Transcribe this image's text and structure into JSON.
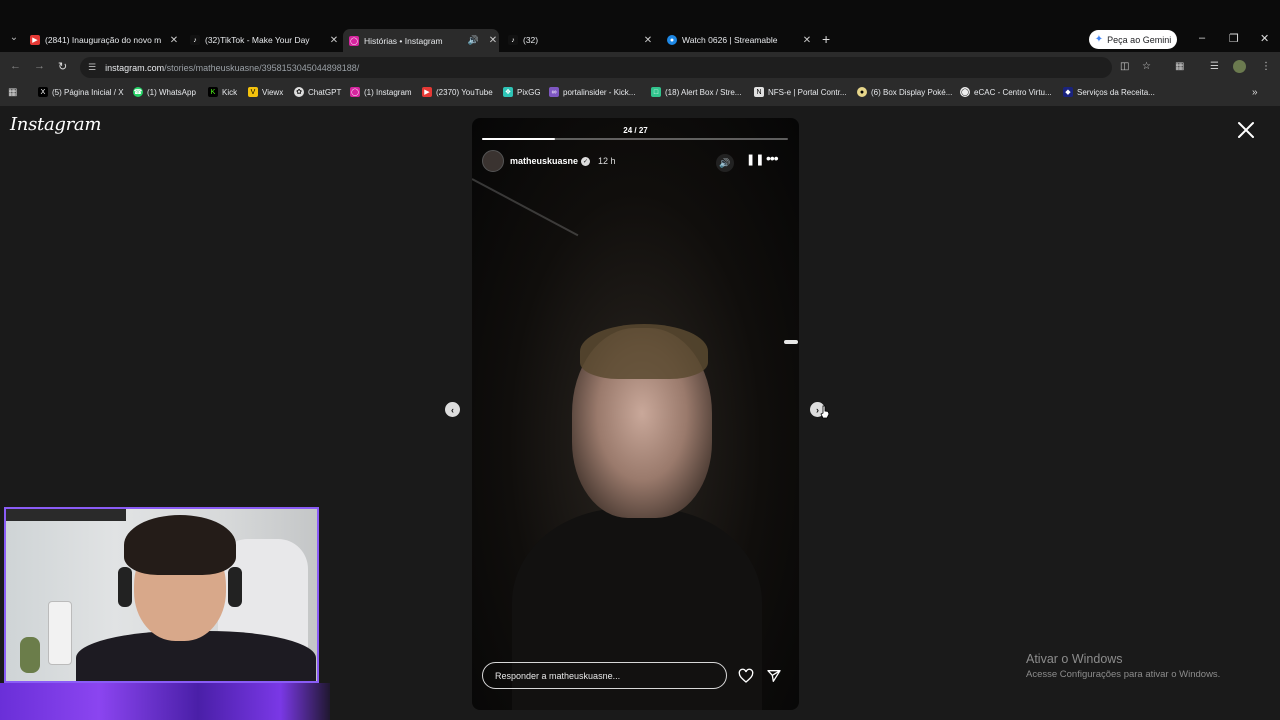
{
  "browser": {
    "tabs": [
      {
        "title": "(2841) Inauguração do novo m",
        "favicon": "youtube-icon",
        "color": "#e53935"
      },
      {
        "title": "(32)TikTok - Make Your Day",
        "favicon": "tiktok-icon",
        "color": "#111111"
      },
      {
        "title": "Histórias • Instagram",
        "favicon": "instagram-icon",
        "color": "#d6249f",
        "active": true
      },
      {
        "title": "(32)",
        "favicon": "tiktok-icon",
        "color": "#111111"
      },
      {
        "title": "Watch 0626 | Streamable",
        "favicon": "streamable-icon",
        "color": "#1e88e5"
      }
    ],
    "gemini_label": "Peça ao Gemini",
    "url_host": "instagram.com",
    "url_path": "/stories/matheuskuasne/3958153045044898188/",
    "bookmarks": [
      {
        "label": "(5) Página Inicial / X",
        "icon": "x-icon",
        "color": "#000000"
      },
      {
        "label": "(1) WhatsApp",
        "icon": "whatsapp-icon",
        "color": "#25d366"
      },
      {
        "label": "Kick",
        "icon": "kick-icon",
        "color": "#53fc18"
      },
      {
        "label": "Viewx",
        "icon": "viewx-icon",
        "color": "#f4c20d"
      },
      {
        "label": "ChatGPT",
        "icon": "chatgpt-icon",
        "color": "#dddddd"
      },
      {
        "label": "(1) Instagram",
        "icon": "instagram-icon",
        "color": "#d6249f"
      },
      {
        "label": "(2370) YouTube",
        "icon": "youtube-icon",
        "color": "#e53935"
      },
      {
        "label": "PixGG",
        "icon": "pixgg-icon",
        "color": "#2ec4b6"
      },
      {
        "label": "portalinsider - Kick...",
        "icon": "portalinsider-icon",
        "color": "#7e57c2"
      },
      {
        "label": "(18) Alert Box / Stre...",
        "icon": "alertbox-icon",
        "color": "#31c48d"
      },
      {
        "label": "NFS-e | Portal Contr...",
        "icon": "nfse-icon",
        "color": "#e0e0e0"
      },
      {
        "label": "(6) Box Display Poké...",
        "icon": "pokemon-icon",
        "color": "#e6d58a"
      },
      {
        "label": "eCAC - Centro Virtu...",
        "icon": "ecac-icon",
        "color": "#eeeeee"
      },
      {
        "label": "Serviços da Receita...",
        "icon": "receita-icon",
        "color": "#1a237e"
      }
    ]
  },
  "instagram": {
    "logo": "Instagram",
    "story": {
      "counter": "24 / 27",
      "progress": 0.24,
      "username": "matheuskuasne",
      "time_ago": "12 h",
      "reply_placeholder": "Responder a matheuskuasne..."
    }
  },
  "windows_watermark": {
    "title": "Ativar o Windows",
    "subtitle": "Acesse Configurações para ativar o Windows."
  }
}
